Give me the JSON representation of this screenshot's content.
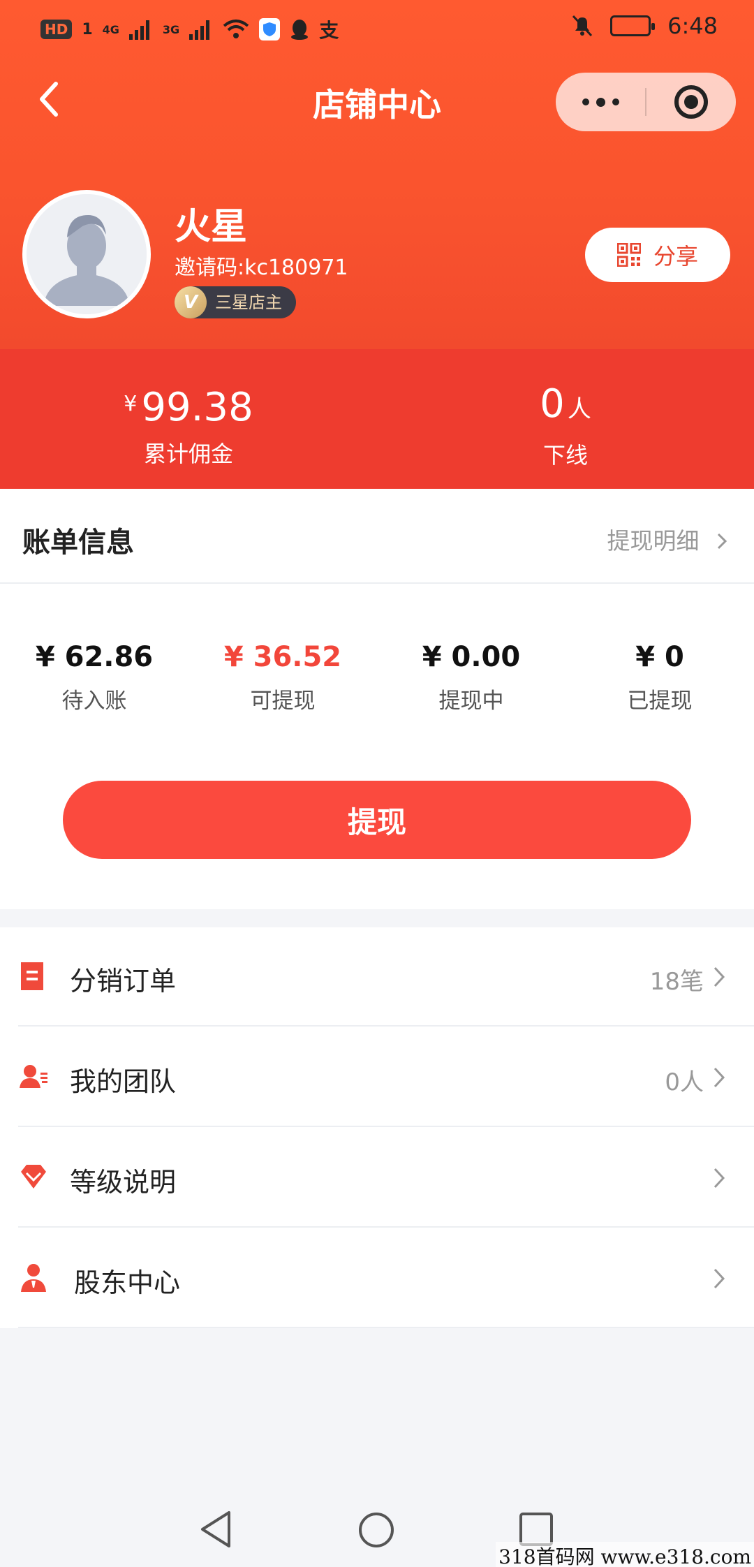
{
  "status_bar": {
    "left_tags": [
      "HD",
      "1",
      "4G",
      "3G"
    ],
    "time": "6:48",
    "alipay_glyph": "支"
  },
  "navbar": {
    "title": "店铺中心"
  },
  "profile": {
    "name": "火星",
    "invite_code": "邀请码:kc180971",
    "level_badge": "三星店主",
    "badge_glyph": "V",
    "share_label": "分享"
  },
  "summary": {
    "commission_currency": "¥",
    "commission_value": "99.38",
    "commission_label": "累计佣金",
    "downline_value": "0",
    "downline_unit": "人",
    "downline_label": "下线"
  },
  "bill": {
    "title": "账单信息",
    "detail_link": "提现明细",
    "items": [
      {
        "value": "¥ 62.86",
        "label": "待入账"
      },
      {
        "value": "¥ 36.52",
        "label": "可提现"
      },
      {
        "value": "¥ 0.00",
        "label": "提现中"
      },
      {
        "value": "¥ 0",
        "label": "已提现"
      }
    ],
    "withdraw_button": "提现"
  },
  "menu": [
    {
      "label": "分销订单",
      "value": "18笔",
      "icon": "document-icon"
    },
    {
      "label": "我的团队",
      "value": "0人",
      "icon": "team-icon"
    },
    {
      "label": "等级说明",
      "value": "",
      "icon": "diamond-icon"
    },
    {
      "label": "股东中心",
      "value": "",
      "icon": "shareholder-icon"
    }
  ],
  "watermark": "318首码网  www.e318.com",
  "colors": {
    "header_start": "#ff5a30",
    "stats_band": "#ee3c2f",
    "accent_red": "#f2463a",
    "button_red": "#fb4a3e"
  }
}
